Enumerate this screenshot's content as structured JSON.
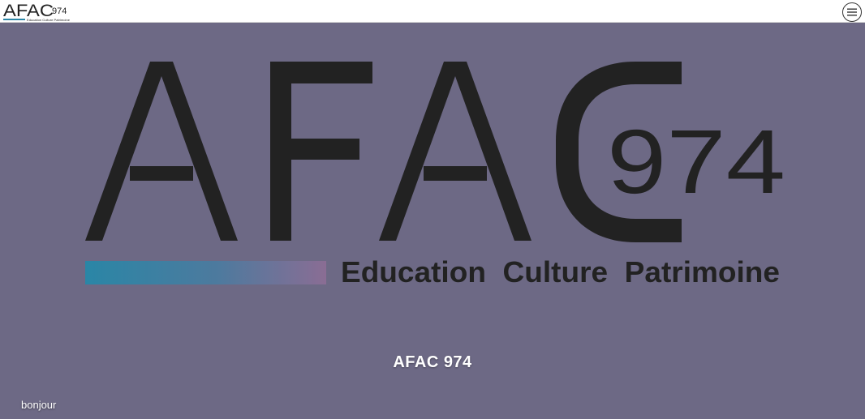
{
  "header": {
    "logo": {
      "main_text": "AFAC",
      "number": "974",
      "tagline": "Education Culture Patrimoine"
    },
    "menu_icon": "hamburger-menu-icon"
  },
  "hero": {
    "logo": {
      "letters": [
        "A",
        "F",
        "A",
        "C"
      ],
      "number": "974",
      "tagline": "Education  Culture  Patrimoine"
    },
    "title": "AFAC 974"
  },
  "footer": {
    "text": "bonjour"
  },
  "colors": {
    "background": "#6d6985",
    "logo_dark": "#222222",
    "header_bg": "#ffffff",
    "gradient_start": "#2a86a6",
    "gradient_end": "#8a6d94"
  }
}
